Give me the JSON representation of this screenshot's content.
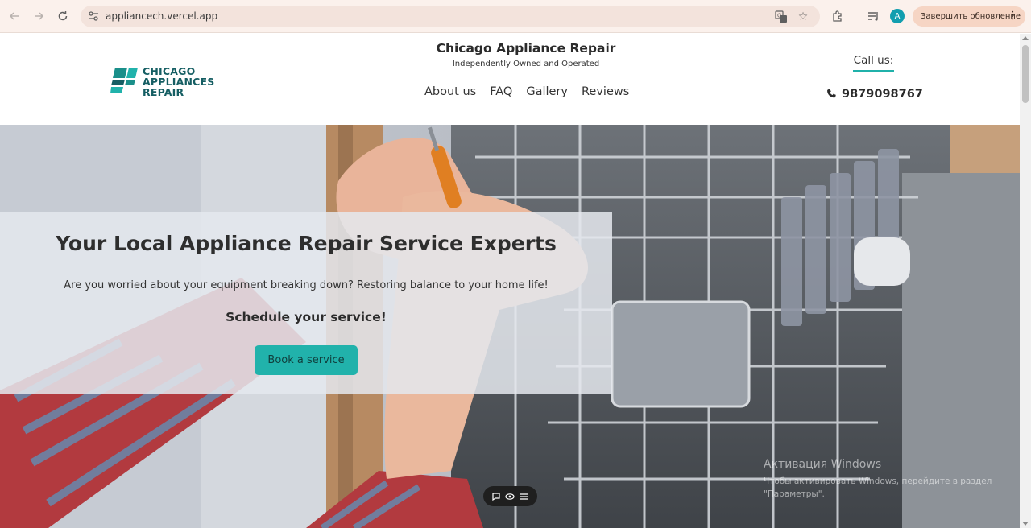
{
  "browser": {
    "url": "appliancech.vercel.app",
    "profile_initial": "A",
    "update_button_label": "Завершить обновление",
    "icons": [
      "back-icon",
      "forward-icon",
      "reload-icon",
      "site-settings-icon",
      "translate-icon",
      "bookmark-star-icon",
      "extensions-icon",
      "reading-list-icon",
      "menu-dots-icon"
    ]
  },
  "site": {
    "logo_line1": "CHICAGO",
    "logo_line2": "APPLIANCES",
    "logo_line3": "REPAIR",
    "title": "Chicago Appliance Repair",
    "tagline": "Independently Owned and Operated",
    "nav": [
      "About us",
      "FAQ",
      "Gallery",
      "Reviews"
    ],
    "call_label": "Call us:",
    "phone": "9879098767",
    "brand_color": "#21b2ab",
    "logo_color": "#155e63"
  },
  "hero": {
    "title": "Your Local Appliance Repair Service Experts",
    "subtitle": "Are you worried about your equipment breaking down? Restoring balance to your home life!",
    "cta_text": "Schedule your service!",
    "button_label": "Book a service"
  },
  "windows_watermark": {
    "title": "Активация Windows",
    "line1": "Чтобы активировать Windows, перейдите в раздел",
    "line2": "\"Параметры\"."
  }
}
